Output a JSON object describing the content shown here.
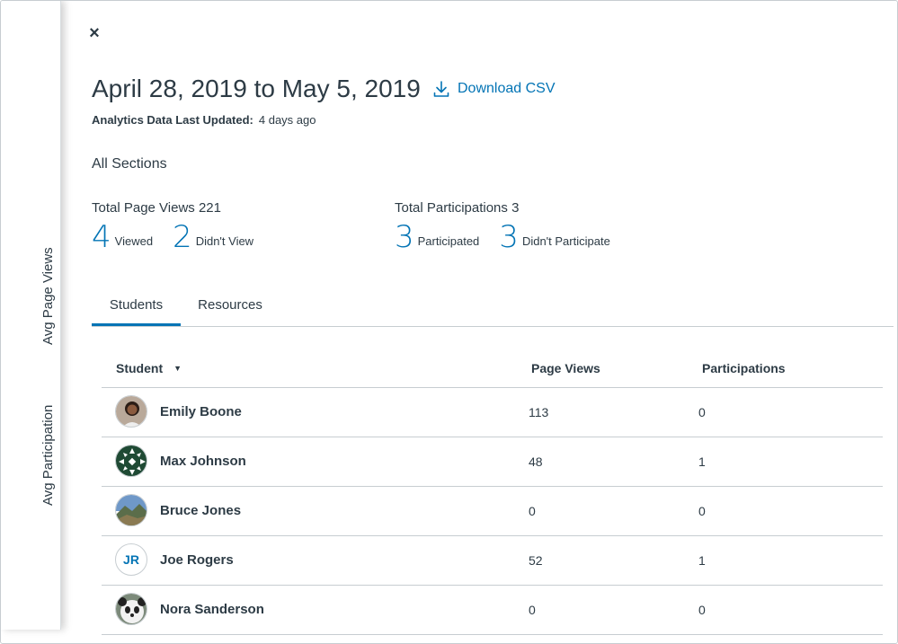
{
  "rail": {
    "avg_page_views": "Avg Page Views",
    "avg_participation": "Avg Participation"
  },
  "close_glyph": "×",
  "header": {
    "title": "April 28, 2019 to May 5, 2019",
    "download_label": "Download CSV",
    "updated_label": "Analytics Data Last Updated:",
    "updated_value": "4 days ago",
    "sections": "All Sections"
  },
  "stats": {
    "page_views_heading": "Total Page Views 221",
    "viewed_count": "4",
    "viewed_label": "Viewed",
    "didnt_view_count": "2",
    "didnt_view_label": "Didn't View",
    "participations_heading": "Total Participations 3",
    "participated_count": "3",
    "participated_label": "Participated",
    "didnt_participate_count": "3",
    "didnt_participate_label": "Didn't Participate"
  },
  "tabs": [
    {
      "label": "Students",
      "active": true
    },
    {
      "label": "Resources",
      "active": false
    }
  ],
  "table": {
    "columns": {
      "student": "Student",
      "page_views": "Page Views",
      "participations": "Participations"
    },
    "sort_glyph": "▼",
    "rows": [
      {
        "name": "Emily Boone",
        "page_views": "113",
        "participations": "0",
        "avatar": "photo"
      },
      {
        "name": "Max Johnson",
        "page_views": "48",
        "participations": "1",
        "avatar": "pattern"
      },
      {
        "name": "Bruce Jones",
        "page_views": "0",
        "participations": "0",
        "avatar": "landscape"
      },
      {
        "name": "Joe Rogers",
        "page_views": "52",
        "participations": "1",
        "avatar": "initials",
        "initials": "JR"
      },
      {
        "name": "Nora Sanderson",
        "page_views": "0",
        "participations": "0",
        "avatar": "panda"
      }
    ]
  },
  "colors": {
    "accent": "#0374b5",
    "text": "#2d3b45",
    "border": "#c7cdd1"
  }
}
